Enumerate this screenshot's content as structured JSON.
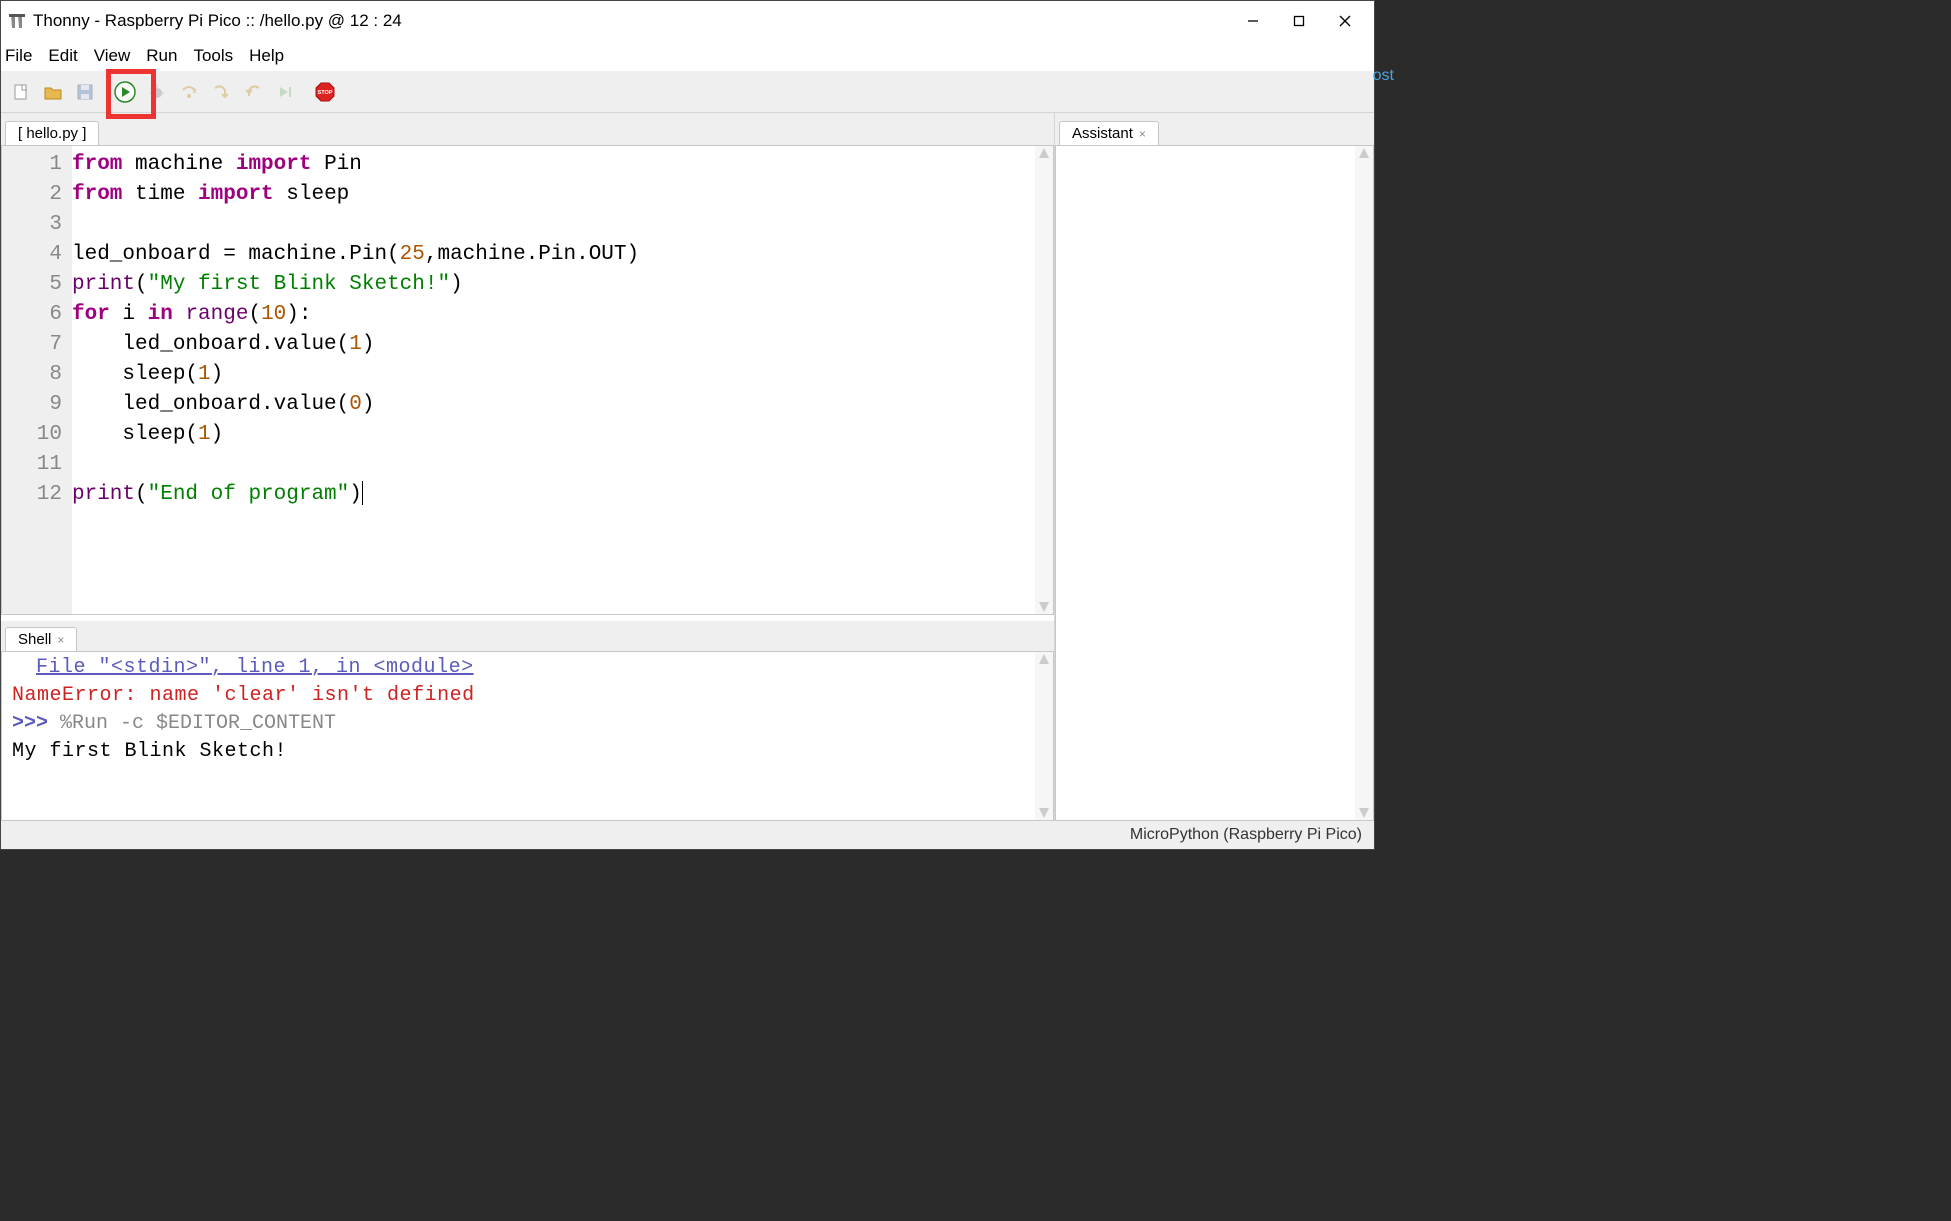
{
  "titlebar": {
    "app_name": "Thonny",
    "sub": "Raspberry Pi Pico :: /hello.py  @  12 : 24",
    "full": "Thonny  -  Raspberry Pi Pico :: /hello.py  @  12 : 24"
  },
  "menu": {
    "file": "File",
    "edit": "Edit",
    "view": "View",
    "run": "Run",
    "tools": "Tools",
    "help": "Help"
  },
  "toolbar_icons": {
    "new": "new-file-icon",
    "open": "open-file-icon",
    "save": "save-icon",
    "run": "run-icon",
    "debug": "debug-icon",
    "step_over": "step-over-icon",
    "step_into": "step-into-icon",
    "step_out": "step-out-icon",
    "resume": "resume-icon",
    "stop": "stop-icon"
  },
  "editor": {
    "tab_label": "[ hello.py ]",
    "lines": [
      "from machine import Pin",
      "from time import sleep",
      "",
      "led_onboard = machine.Pin(25,machine.Pin.OUT)",
      "print(\"My first Blink Sketch!\")",
      "for i in range(10):",
      "    led_onboard.value(1)",
      "    sleep(1)",
      "    led_onboard.value(0)",
      "    sleep(1)",
      "",
      "print(\"End of program\")"
    ],
    "line_numbers": [
      "1",
      "2",
      "3",
      "4",
      "5",
      "6",
      "7",
      "8",
      "9",
      "10",
      "11",
      "12"
    ]
  },
  "shell": {
    "tab_label": "Shell",
    "trace": "File \"<stdin>\", line 1, in <module>",
    "error": "NameError: name 'clear' isn't defined",
    "prompt": ">>> ",
    "command": "%Run -c $EDITOR_CONTENT",
    "output": "My first Blink Sketch!"
  },
  "assistant": {
    "tab_label": "Assistant"
  },
  "statusbar": {
    "interpreter": "MicroPython (Raspberry Pi Pico)"
  },
  "host_fragment": "ost"
}
